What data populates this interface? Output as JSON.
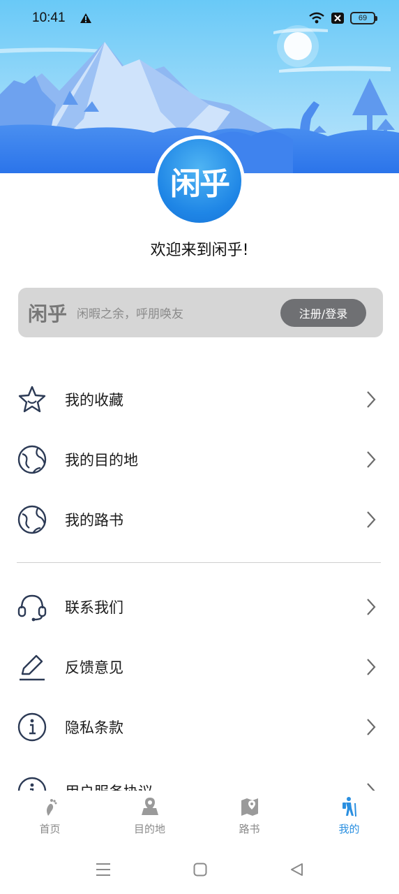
{
  "status_bar": {
    "time": "10:41",
    "battery": "69"
  },
  "header": {
    "logo_text": "闲乎",
    "welcome": "欢迎来到闲乎!"
  },
  "login_card": {
    "logo_text": "闲乎",
    "slogan": "闲暇之余，呼朋唤友",
    "button_label": "注册/登录"
  },
  "menu_group_1": [
    {
      "label": "我的收藏",
      "icon": "star-icon"
    },
    {
      "label": "我的目的地",
      "icon": "globe-icon"
    },
    {
      "label": "我的路书",
      "icon": "globe-icon"
    }
  ],
  "menu_group_2": [
    {
      "label": "联系我们",
      "icon": "headset-icon"
    },
    {
      "label": "反馈意见",
      "icon": "pencil-icon"
    },
    {
      "label": "隐私条款",
      "icon": "info-icon"
    },
    {
      "label": "用户服务协议",
      "icon": "info-icon"
    }
  ],
  "tabs": [
    {
      "label": "首页",
      "icon": "footprint-icon",
      "active": false
    },
    {
      "label": "目的地",
      "icon": "map-pin-icon",
      "active": false
    },
    {
      "label": "路书",
      "icon": "roadbook-icon",
      "active": false
    },
    {
      "label": "我的",
      "icon": "hiker-icon",
      "active": true
    }
  ],
  "colors": {
    "accent": "#2a8fe0",
    "sky_top": "#6cc8f6",
    "mountain_blue": "#3d86ef",
    "card_bg": "#d6d6d6",
    "button_bg": "#6f7073"
  }
}
